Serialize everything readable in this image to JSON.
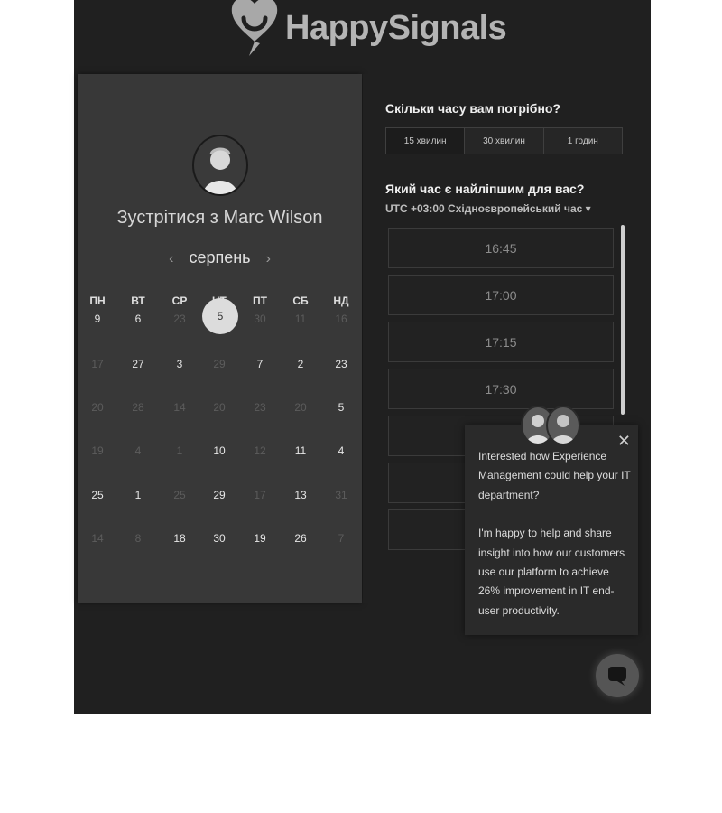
{
  "brand": {
    "name": "HappySignals"
  },
  "calendar": {
    "title": "Зустрітися з Marc Wilson",
    "month": "серпень",
    "prev_icon": "chevron-left-icon",
    "next_icon": "chevron-right-icon",
    "weekdays": [
      "ПН",
      "ВТ",
      "СР",
      "ЧТ",
      "ПТ",
      "СБ",
      "НД"
    ],
    "selected_day": "5",
    "rows": [
      [
        {
          "d": "9",
          "a": true
        },
        {
          "d": "6",
          "a": true
        },
        {
          "d": "23",
          "a": false
        },
        {
          "d": "5",
          "a": true,
          "sel": true
        },
        {
          "d": "30",
          "a": false
        },
        {
          "d": "11",
          "a": false
        },
        {
          "d": "16",
          "a": false
        }
      ],
      [
        {
          "d": "17",
          "a": false
        },
        {
          "d": "27",
          "a": true
        },
        {
          "d": "3",
          "a": true
        },
        {
          "d": "29",
          "a": false
        },
        {
          "d": "7",
          "a": true
        },
        {
          "d": "2",
          "a": true
        },
        {
          "d": "23",
          "a": true
        }
      ],
      [
        {
          "d": "20",
          "a": false
        },
        {
          "d": "28",
          "a": false
        },
        {
          "d": "14",
          "a": false
        },
        {
          "d": "20",
          "a": false
        },
        {
          "d": "23",
          "a": false
        },
        {
          "d": "20",
          "a": false
        },
        {
          "d": "5",
          "a": true
        }
      ],
      [
        {
          "d": "19",
          "a": false
        },
        {
          "d": "4",
          "a": false
        },
        {
          "d": "1",
          "a": false
        },
        {
          "d": "10",
          "a": true
        },
        {
          "d": "12",
          "a": false
        },
        {
          "d": "11",
          "a": true
        },
        {
          "d": "4",
          "a": true
        }
      ],
      [
        {
          "d": "25",
          "a": true
        },
        {
          "d": "1",
          "a": true
        },
        {
          "d": "25",
          "a": false
        },
        {
          "d": "29",
          "a": true
        },
        {
          "d": "17",
          "a": false
        },
        {
          "d": "13",
          "a": true
        },
        {
          "d": "31",
          "a": false
        }
      ],
      [
        {
          "d": "14",
          "a": false
        },
        {
          "d": "8",
          "a": false
        },
        {
          "d": "18",
          "a": true
        },
        {
          "d": "30",
          "a": true
        },
        {
          "d": "19",
          "a": true
        },
        {
          "d": "26",
          "a": true
        },
        {
          "d": "7",
          "a": false
        }
      ]
    ]
  },
  "booking": {
    "duration_question": "Скільки часу вам потрібно?",
    "durations": [
      "15 хвилин",
      "30 хвилин",
      "1 годин"
    ],
    "selected_duration": "15 хвилин",
    "time_question": "Який час є найліпшим для вас?",
    "timezone": "UTC +03:00 Східноєвропейський час ▾",
    "slots": [
      "16:45",
      "17:00",
      "17:15",
      "17:30",
      "",
      "",
      ""
    ]
  },
  "chat": {
    "message_1": "Interested how Experience Management could help your IT department?",
    "message_2": "I'm happy to help and share insight into how our customers use our platform to achieve 26% improvement in IT end-user productivity.",
    "close_icon": "close-icon",
    "launcher_icon": "chat-bubble-icon"
  },
  "colors": {
    "background": "#202020",
    "panel": "#383838",
    "selected": "#dcdcdc"
  }
}
